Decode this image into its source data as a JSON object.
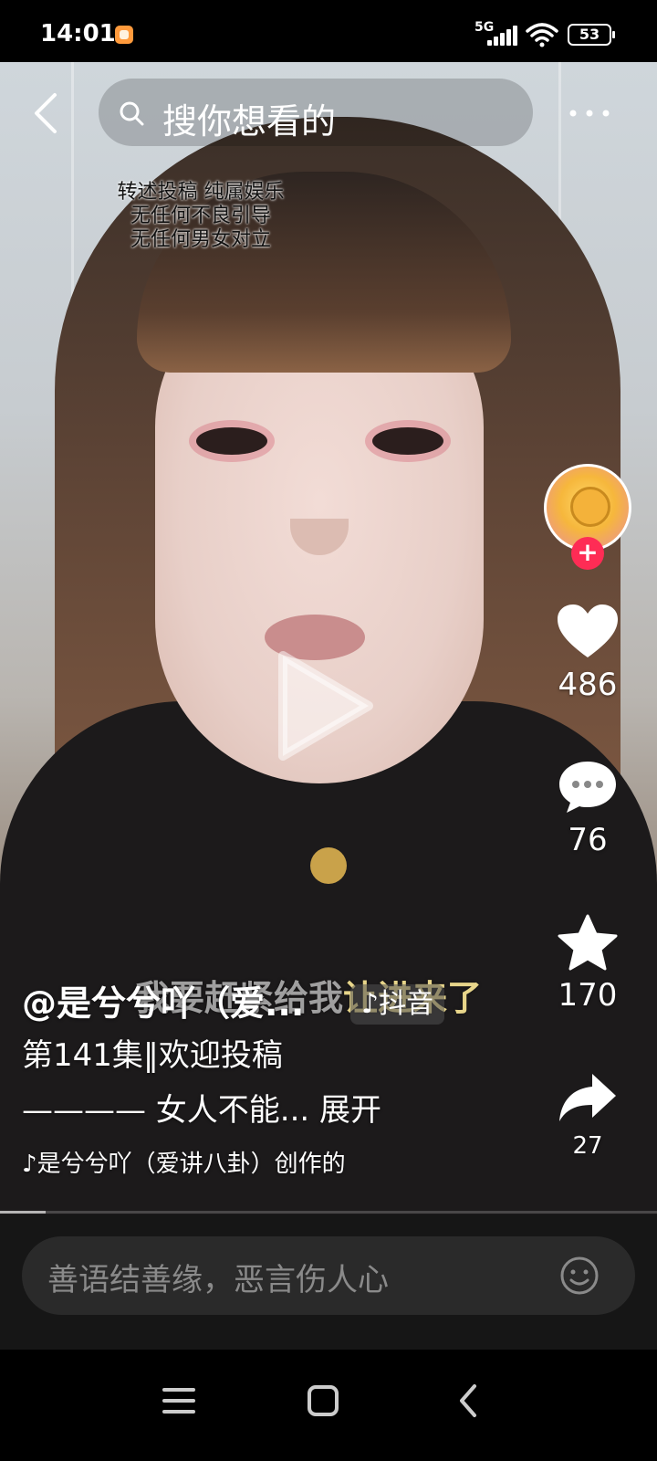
{
  "status": {
    "time": "14:01",
    "network": "5G",
    "battery": "53"
  },
  "search": {
    "placeholder": "搜你想看的"
  },
  "video": {
    "top_subtitle": [
      "转述投稿 纯属娱乐",
      "无任何不良引导",
      "无任何男女对立"
    ],
    "overlay_text_dim": "我要赶紧给我",
    "overlay_text": "让进来了",
    "brand": "♪抖音"
  },
  "actions": {
    "likes": "486",
    "comments": "76",
    "favorites": "170",
    "shares": "27"
  },
  "caption": {
    "author": "@是兮兮吖（爱...",
    "desc_line1": "第141集‖欢迎投稿",
    "desc_line2": "———— 女人不能... 展开",
    "music": "♪是兮兮吖（爱讲八卦）创作的"
  },
  "progress": {
    "value": 0.07
  },
  "comment": {
    "placeholder": "善语结善缘，恶言伤人心"
  },
  "colors": {
    "follow": "#fe2c55",
    "subtitle_highlight": "#e7d58a"
  },
  "icons": [
    "back-arrow-icon",
    "search-icon",
    "more-icon",
    "play-icon",
    "heart-icon",
    "comment-icon",
    "star-icon",
    "share-icon",
    "emoji-icon",
    "menu-icon",
    "home-icon",
    "back-icon"
  ]
}
